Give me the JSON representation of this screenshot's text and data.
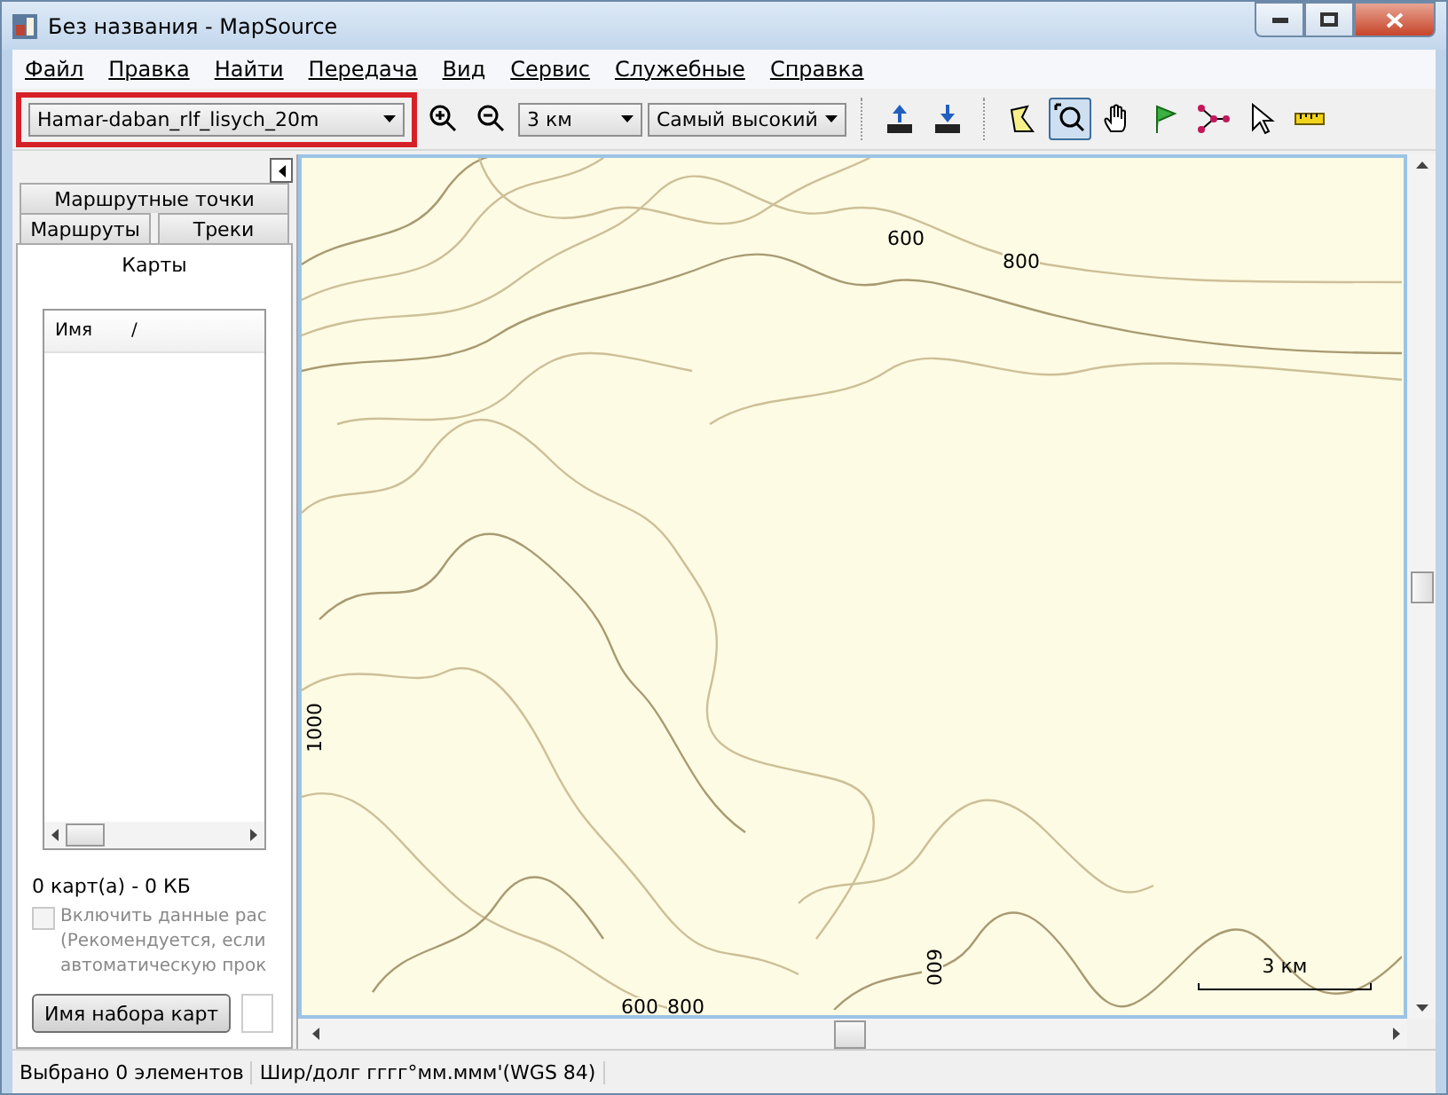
{
  "window": {
    "title": "Без названия - MapSource"
  },
  "menu": [
    "Файл",
    "Правка",
    "Найти",
    "Передача",
    "Вид",
    "Сервис",
    "Служебные",
    "Справка"
  ],
  "toolbar": {
    "map_select": {
      "value": "Hamar-daban_rlf_lisych_20m",
      "highlighted": true
    },
    "scale_select": {
      "value": "3 км"
    },
    "detail_select": {
      "value": "Самый высокий"
    },
    "tools": [
      {
        "kind": "zoom-in",
        "selected": false
      },
      {
        "kind": "zoom-out",
        "selected": false
      },
      {
        "kind": "sep"
      },
      {
        "kind": "upload",
        "selected": false
      },
      {
        "kind": "download",
        "selected": false
      },
      {
        "kind": "sep"
      },
      {
        "kind": "map-select",
        "selected": false
      },
      {
        "kind": "zoom-tool",
        "selected": true
      },
      {
        "kind": "hand",
        "selected": false
      },
      {
        "kind": "flag",
        "selected": false
      },
      {
        "kind": "route",
        "selected": false
      },
      {
        "kind": "pointer",
        "selected": false
      },
      {
        "kind": "ruler",
        "selected": false
      }
    ]
  },
  "sidebar": {
    "tabs_row_1": [
      {
        "label": "Маршрутные точки",
        "selected": false
      }
    ],
    "tabs_row_2": [
      {
        "label": "Маршруты",
        "selected": false
      },
      {
        "label": "Треки",
        "selected": false
      }
    ],
    "tabs_row_3": [
      {
        "label": "Карты",
        "selected": true
      }
    ],
    "table": {
      "columns": [
        "Имя",
        "/"
      ]
    },
    "summary": "0 карт(а) - 0 КБ",
    "checkbox": {
      "label": "Включить данные рас\n(Рекомендуется, если\nавтоматическую прок",
      "checked": false,
      "disabled": true
    },
    "button": "Имя набора карт"
  },
  "map": {
    "labels": [
      "600",
      "800",
      "1000",
      "600",
      "600",
      "800"
    ],
    "scale_label": "3 км"
  },
  "status_bar": [
    "Выбрано 0 элементов",
    "Шир/долг гггг°мм.ммм'(WGS 84)"
  ]
}
